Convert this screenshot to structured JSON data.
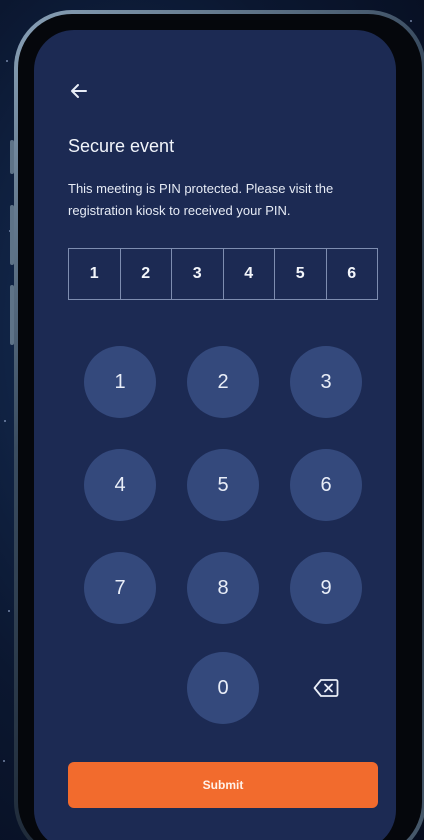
{
  "header": {
    "back_icon": "arrow-left-icon"
  },
  "title": "Secure event",
  "subtitle": "This meeting is PIN protected. Please visit the registration kiosk to received your PIN.",
  "pin": {
    "digits": [
      "1",
      "2",
      "3",
      "4",
      "5",
      "6"
    ]
  },
  "keypad": {
    "keys": [
      "1",
      "2",
      "3",
      "4",
      "5",
      "6",
      "7",
      "8",
      "9",
      "0"
    ],
    "backspace_icon": "backspace-icon"
  },
  "submit_label": "Submit",
  "colors": {
    "screen_bg": "#1c2a53",
    "key_bg": "#34497c",
    "accent": "#f26b2d"
  }
}
